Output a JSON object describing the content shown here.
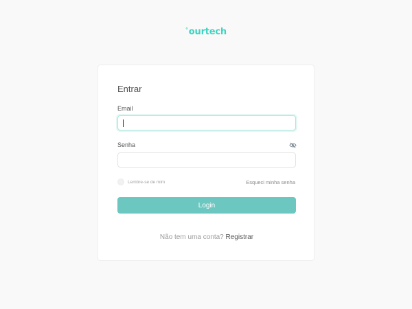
{
  "brand": {
    "logo_text": "ourtech",
    "logo_mark": "°",
    "accent_color": "#3fd3c2"
  },
  "login_form": {
    "title": "Entrar",
    "email_label": "Email",
    "email_value": "",
    "password_label": "Senha",
    "password_value": "",
    "password_toggle_icon": "eye-off-icon",
    "remember_label": "Lembre-se de mim",
    "remember_checked": false,
    "forgot_link": "Esqueci minha senha",
    "login_button": "Login",
    "button_color": "#6cc7c1",
    "signup_prompt": "Não tem uma conta?",
    "signup_link": "Registrar"
  }
}
